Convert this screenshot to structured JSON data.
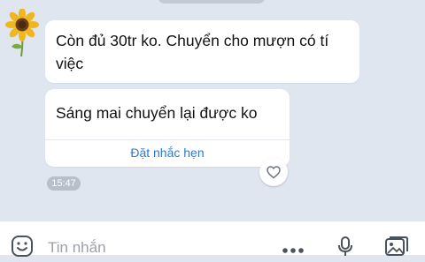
{
  "conversation": {
    "messages": [
      {
        "text": "Còn đủ 30tr ko. Chuyển cho mượn có tí việc"
      },
      {
        "text": "Sáng mai chuyển lại được ko",
        "action_label": "Đặt nhắc hẹn"
      }
    ],
    "timestamp": "15:47"
  },
  "composer": {
    "placeholder": "Tin nhắn"
  },
  "icons": {
    "avatar": "sunflower-avatar",
    "like": "heart-icon",
    "emoji": "emoji-icon",
    "more": "more-dots-icon",
    "voice": "microphone-icon",
    "image": "image-icon"
  },
  "colors": {
    "background": "#dfe6ef",
    "link": "#2a79d4",
    "timestamp_badge": "#b7bfca"
  }
}
